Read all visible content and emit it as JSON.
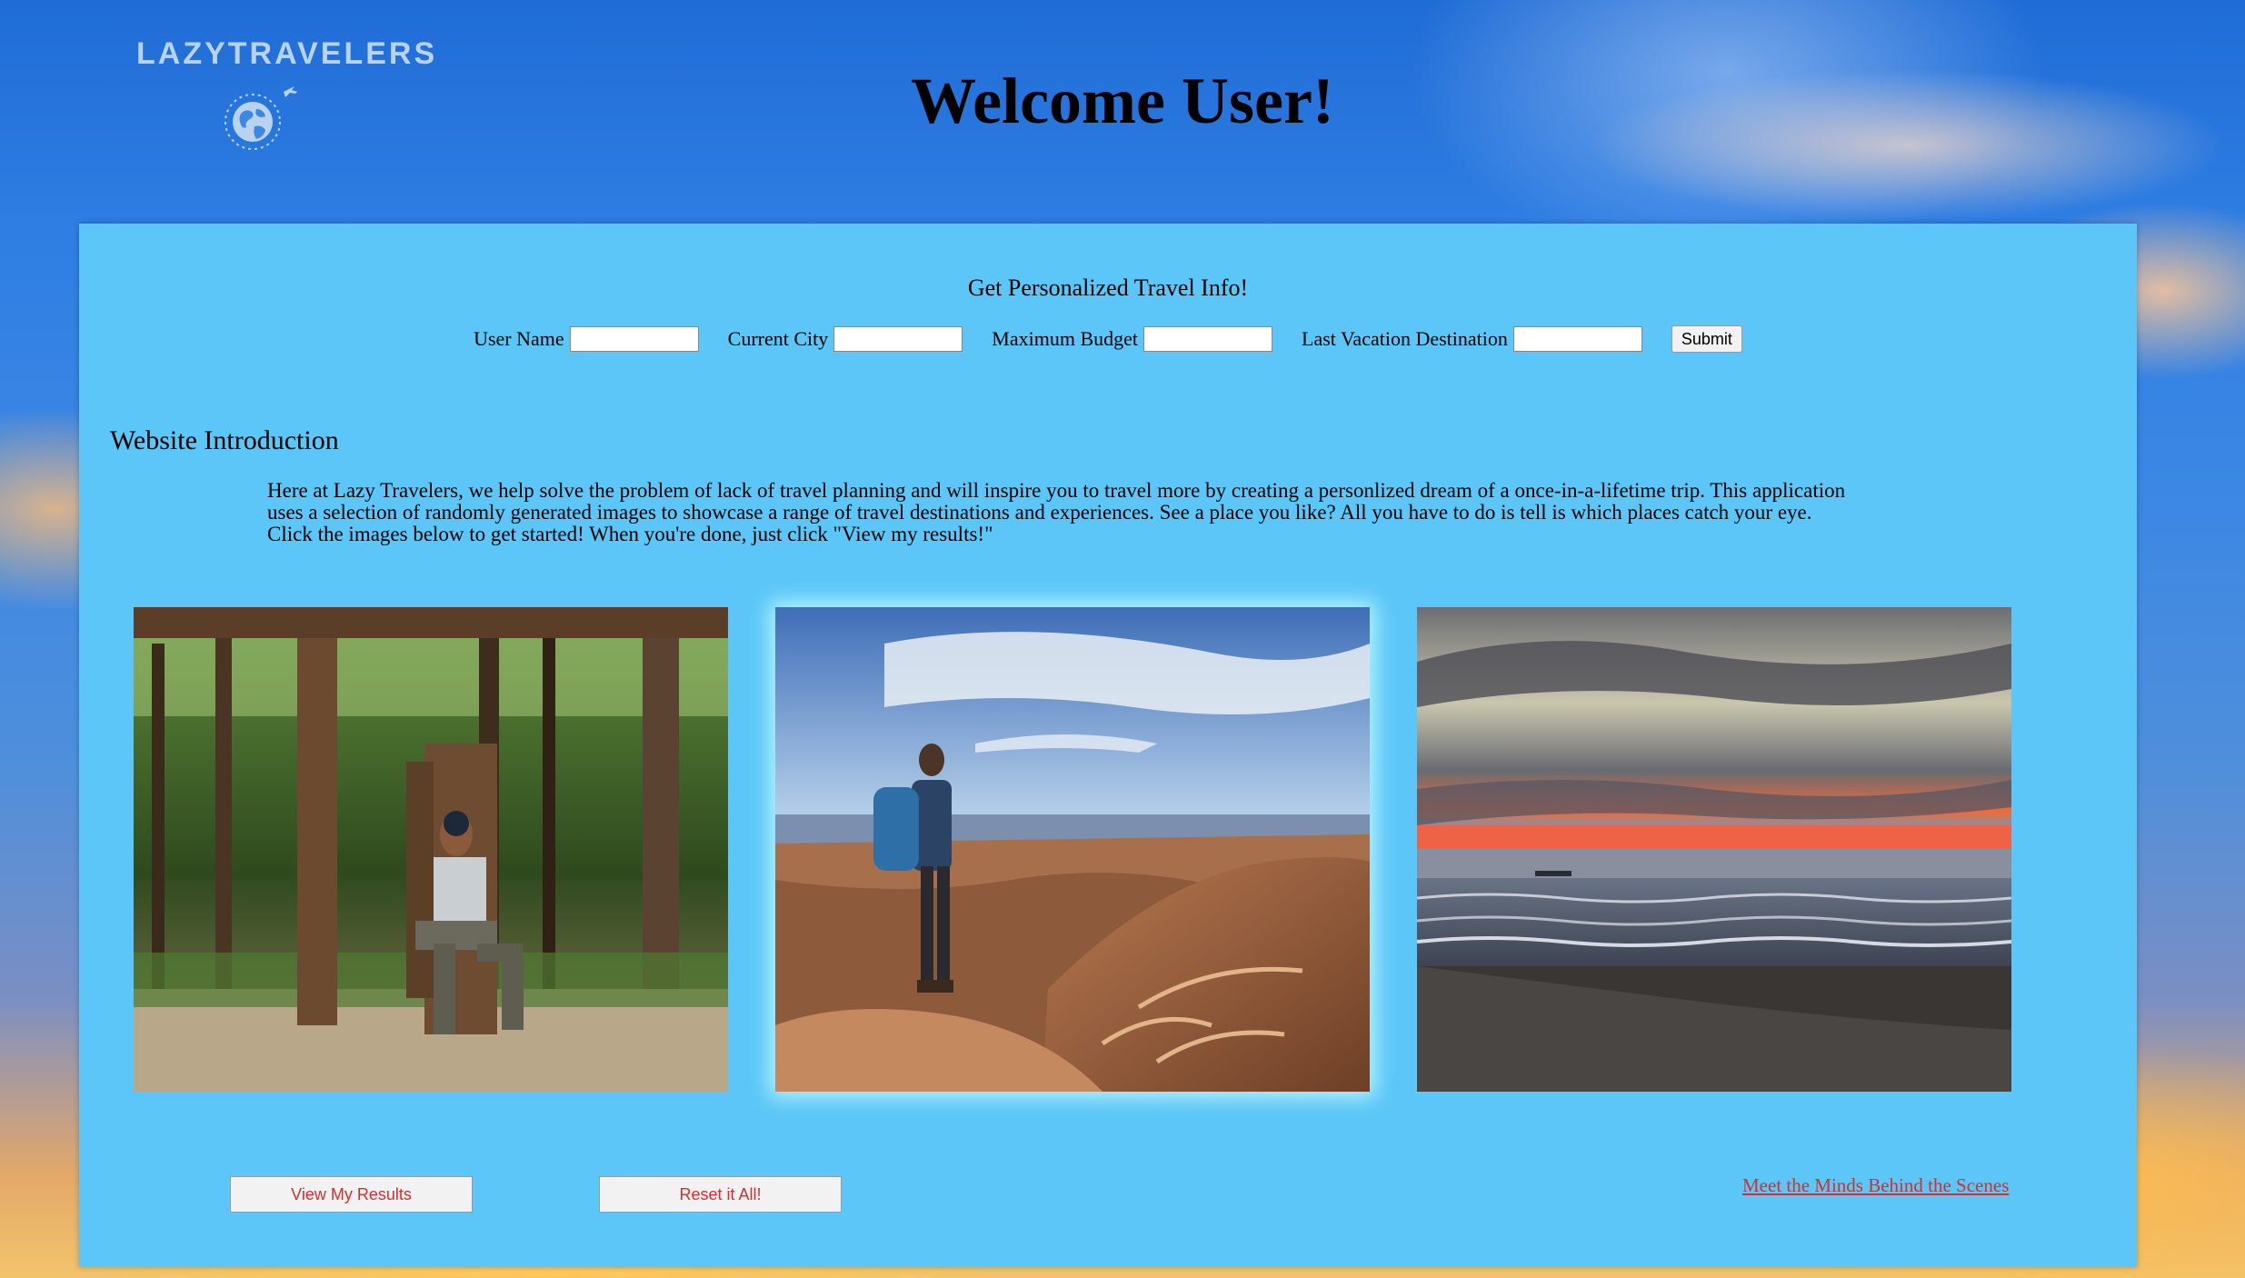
{
  "logo": {
    "text": "LAZYTRAVELERS"
  },
  "page": {
    "title": "Welcome User!"
  },
  "form": {
    "heading": "Get Personalized Travel Info!",
    "fields": [
      {
        "label": "User Name",
        "value": ""
      },
      {
        "label": "Current City",
        "value": ""
      },
      {
        "label": "Maximum Budget",
        "value": ""
      },
      {
        "label": "Last Vacation Destination",
        "value": ""
      }
    ],
    "submit_label": "Submit"
  },
  "intro": {
    "heading": "Website Introduction",
    "text": "Here at Lazy Travelers, we help solve the problem of lack of travel planning and will inspire you to travel more by creating a personlized dream of a once-in-a-lifetime trip. This application uses a selection of randomly generated images to showcase a range of travel destinations and experiences. See a place you like? All you have to do is tell is which places catch your eye. Click the images below to get started! When you're done, just click \"View my results!\""
  },
  "actions": {
    "view_results_label": "View My Results",
    "reset_label": "Reset it All!",
    "team_link_label": "Meet the Minds Behind the Scenes"
  },
  "colors": {
    "panel": "#5bc6f7",
    "button_text": "#d32f2f",
    "logo": "#b9d2ee"
  }
}
